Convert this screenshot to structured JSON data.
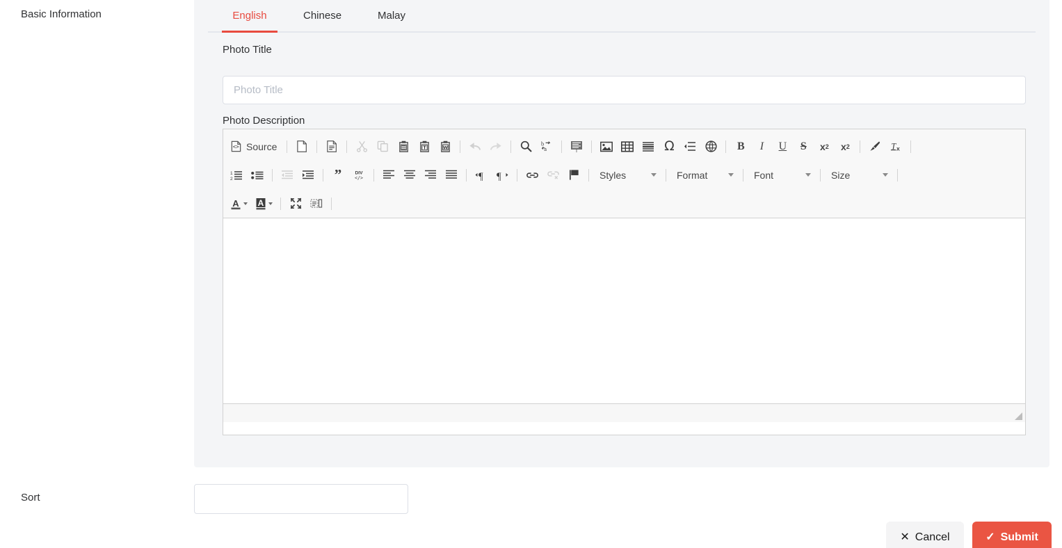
{
  "sidebar": {
    "basic_information_label": "Basic Information",
    "sort_label": "Sort"
  },
  "tabs": {
    "items": [
      {
        "label": "English",
        "active": true
      },
      {
        "label": "Chinese",
        "active": false
      },
      {
        "label": "Malay",
        "active": false
      }
    ],
    "active_color": "#e84a3f"
  },
  "form": {
    "photo_title": {
      "label": "Photo Title",
      "value": "",
      "placeholder": "Photo Title"
    },
    "photo_description": {
      "label": "Photo Description",
      "value": ""
    },
    "sort": {
      "label": "Sort",
      "value": "",
      "placeholder": ""
    }
  },
  "editor": {
    "source_label": "Source",
    "row1": [
      "source-icon",
      "new-page-icon",
      "templates-icon",
      "cut-icon",
      "copy-icon",
      "paste-icon",
      "paste-text-icon",
      "paste-word-icon",
      "undo-icon",
      "redo-icon",
      "find-icon",
      "replace-select-all-icon",
      "select-all-icon",
      "image-icon",
      "table-icon",
      "horizontal-rule-icon",
      "special-char-icon",
      "page-break-icon",
      "iframe-icon",
      "bold-icon",
      "italic-icon",
      "underline-icon",
      "strikethrough-icon",
      "subscript-icon",
      "superscript-icon",
      "remove-format-brush-icon",
      "remove-format-icon"
    ],
    "row2": [
      "numbered-list-icon",
      "bulleted-list-icon",
      "decrease-indent-icon",
      "increase-indent-icon",
      "blockquote-icon",
      "div-container-icon",
      "align-left-icon",
      "align-center-icon",
      "align-right-icon",
      "justify-icon",
      "ltr-icon",
      "rtl-icon",
      "link-icon",
      "unlink-icon",
      "anchor-icon"
    ],
    "row3": [
      "text-color-icon",
      "background-color-icon",
      "maximize-icon",
      "show-blocks-icon"
    ],
    "dropdowns": [
      {
        "name": "styles",
        "label": "Styles"
      },
      {
        "name": "format",
        "label": "Format"
      },
      {
        "name": "font",
        "label": "Font"
      },
      {
        "name": "size",
        "label": "Size"
      }
    ]
  },
  "footer": {
    "cancel_label": "Cancel",
    "cancel_icon": "close-icon",
    "submit_label": "Submit",
    "submit_icon": "check-icon",
    "submit_color": "#ea5543"
  }
}
